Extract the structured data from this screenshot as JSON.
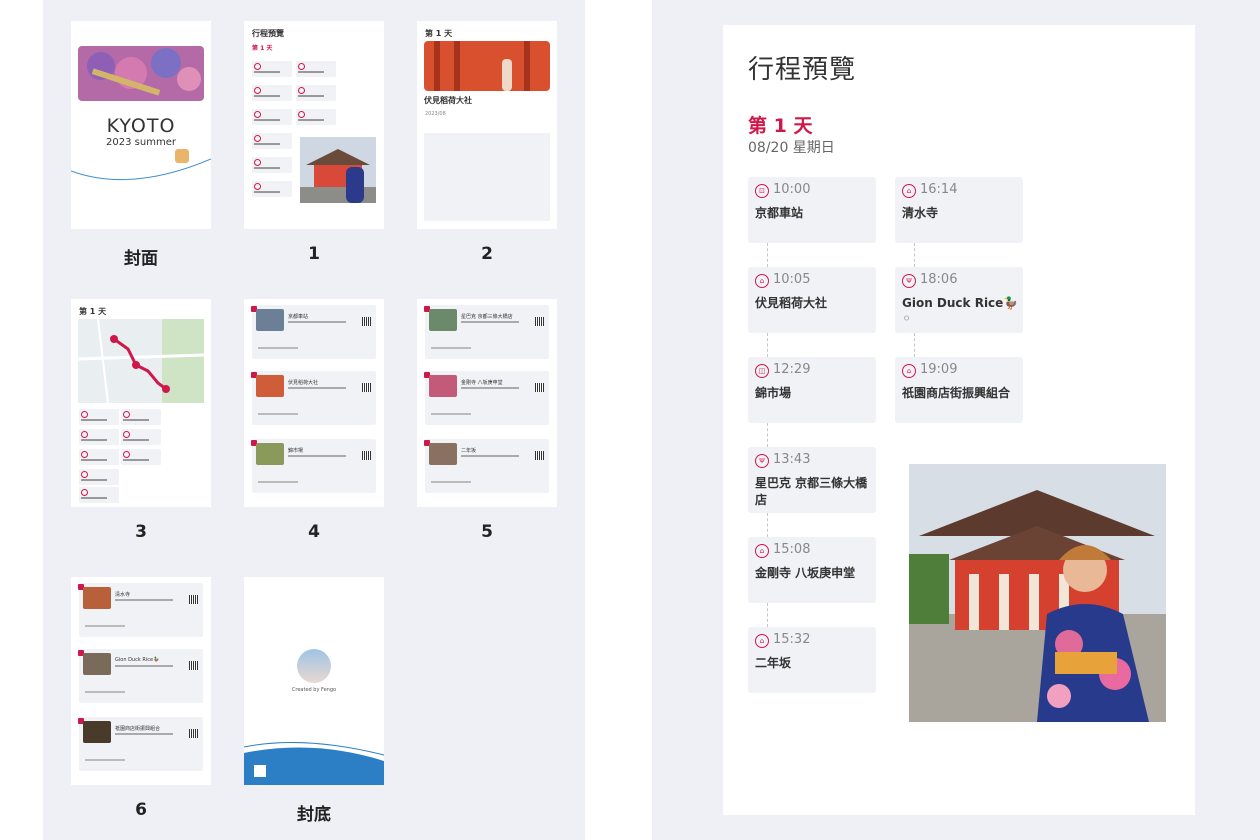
{
  "thumbnails": {
    "labels": [
      "封面",
      "1",
      "2",
      "3",
      "4",
      "5",
      "6",
      "封底"
    ],
    "cover": {
      "title": "KYOTO",
      "subtitle": "2023 summer"
    },
    "page1": {
      "title": "行程預覽",
      "day": "第 1 天"
    },
    "page2": {
      "day": "第 1 天",
      "spot": "伏見稻荷大社",
      "date": "2023/08"
    },
    "page3": {
      "day": "第 1 天"
    },
    "page4": {
      "items": [
        "京都車站",
        "伏見稻荷大社",
        "錦市場"
      ]
    },
    "page5": {
      "items": [
        "星巴克 京都三條大橋店",
        "金剛寺 八坂庚申堂",
        "二年坂"
      ]
    },
    "page6": {
      "items": [
        "清水寺",
        "Gion Duck Rice🦆",
        "祇園商店街振興組合"
      ]
    },
    "back": {
      "credit": "Created by Fengo"
    }
  },
  "preview": {
    "title": "行程預覽",
    "day_title": "第 1 天",
    "day_date": "08/20 星期日",
    "left_column": [
      {
        "time": "10:00",
        "place": "京都車站",
        "icon": "train-icon",
        "glyph": "⊡"
      },
      {
        "time": "10:05",
        "place": "伏見稻荷大社",
        "icon": "temple-icon",
        "glyph": "⌂"
      },
      {
        "time": "12:29",
        "place": "錦市場",
        "icon": "shopping-bag-icon",
        "glyph": "◫"
      },
      {
        "time": "13:43",
        "place": "星巴克 京都三條大橋店",
        "icon": "restaurant-icon",
        "glyph": "Ψ"
      },
      {
        "time": "15:08",
        "place": "金剛寺 八坂庚申堂",
        "icon": "temple-icon",
        "glyph": "⌂"
      },
      {
        "time": "15:32",
        "place": "二年坂",
        "icon": "temple-icon",
        "glyph": "⌂"
      }
    ],
    "right_column": [
      {
        "time": "16:14",
        "place": "清水寺",
        "icon": "temple-icon",
        "glyph": "⌂"
      },
      {
        "time": "18:06",
        "place": "Gion Duck Rice🦆",
        "icon": "restaurant-icon",
        "glyph": "Ψ",
        "extra": "⚪"
      },
      {
        "time": "19:09",
        "place": "祇園商店街振興組合",
        "icon": "temple-icon",
        "glyph": "⌂"
      }
    ]
  },
  "colors": {
    "accent": "#d0174a",
    "panel_bg": "#eef0f5",
    "card_bg": "#f1f2f6"
  }
}
